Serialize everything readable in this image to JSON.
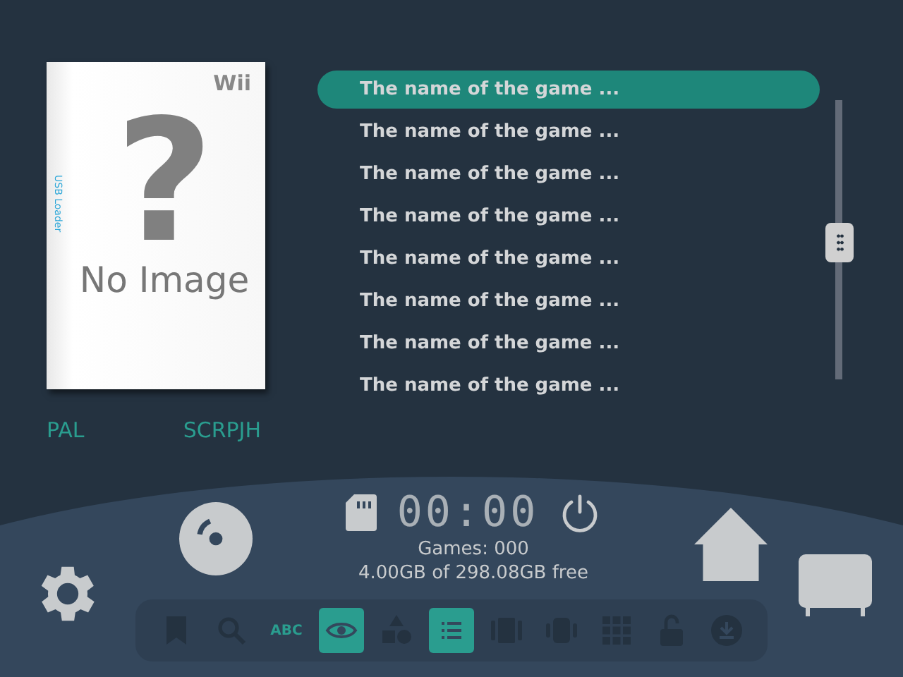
{
  "cover": {
    "brand": "Wii",
    "spine": "USB Loader",
    "mark": "?",
    "caption": "No Image"
  },
  "region": "PAL",
  "game_id": "SCRPJH",
  "games": [
    {
      "title": "The name of the game ...",
      "selected": true
    },
    {
      "title": "The name of the game ...",
      "selected": false
    },
    {
      "title": "The name of the game ...",
      "selected": false
    },
    {
      "title": "The name of the game ...",
      "selected": false
    },
    {
      "title": "The name of the game ...",
      "selected": false
    },
    {
      "title": "The name of the game ...",
      "selected": false
    },
    {
      "title": "The name of the game ...",
      "selected": false
    },
    {
      "title": "The name of the game ...",
      "selected": false
    }
  ],
  "clock": "00:00",
  "games_count": "Games: 000",
  "storage": "4.00GB of 298.08GB free",
  "toolbar": [
    {
      "kind": "bookmark",
      "on": false
    },
    {
      "kind": "search",
      "on": false
    },
    {
      "kind": "abc",
      "label": "ABC",
      "on": true
    },
    {
      "kind": "eye",
      "on": true
    },
    {
      "kind": "shapes",
      "on": false
    },
    {
      "kind": "list",
      "on": true
    },
    {
      "kind": "carousel",
      "on": false
    },
    {
      "kind": "rotate",
      "on": false
    },
    {
      "kind": "grid",
      "on": false
    },
    {
      "kind": "lock",
      "on": false
    },
    {
      "kind": "download",
      "on": false
    }
  ]
}
